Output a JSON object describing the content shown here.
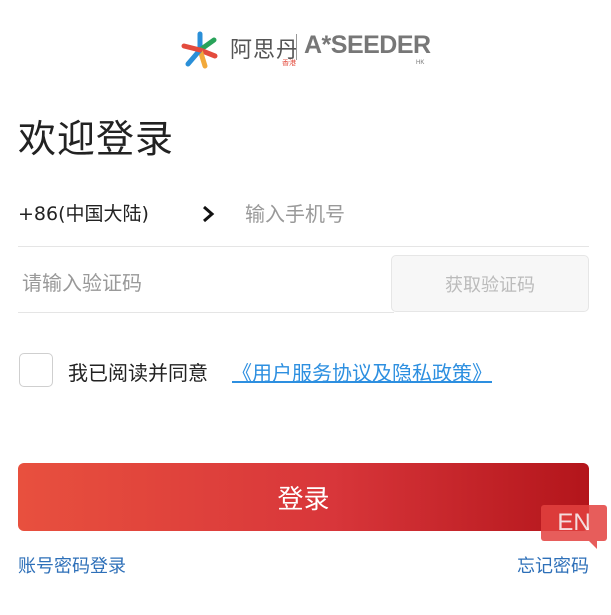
{
  "logo": {
    "cn_name": "阿思丹",
    "cn_sub": "香港",
    "en_name": "A*SEEDER",
    "en_sub": "HK"
  },
  "title": "欢迎登录",
  "phone": {
    "country_code": "+86(中国大陆)",
    "placeholder": "输入手机号"
  },
  "code": {
    "placeholder": "请输入验证码",
    "button_label": "获取验证码"
  },
  "agreement": {
    "text": "我已阅读并同意",
    "link": "《用户服务协议及隐私政策》"
  },
  "login_button": "登录",
  "links": {
    "password_login": "账号密码登录",
    "forgot_password": "忘记密码"
  },
  "language_badge": "EN",
  "colors": {
    "brand_red": "#e3413f",
    "link_blue": "#2d8fe0",
    "link_dark_blue": "#2d6fb8"
  },
  "icons": {
    "brand_mark": "asterisk-logo-icon",
    "country_arrow": "chevron-right-icon"
  }
}
